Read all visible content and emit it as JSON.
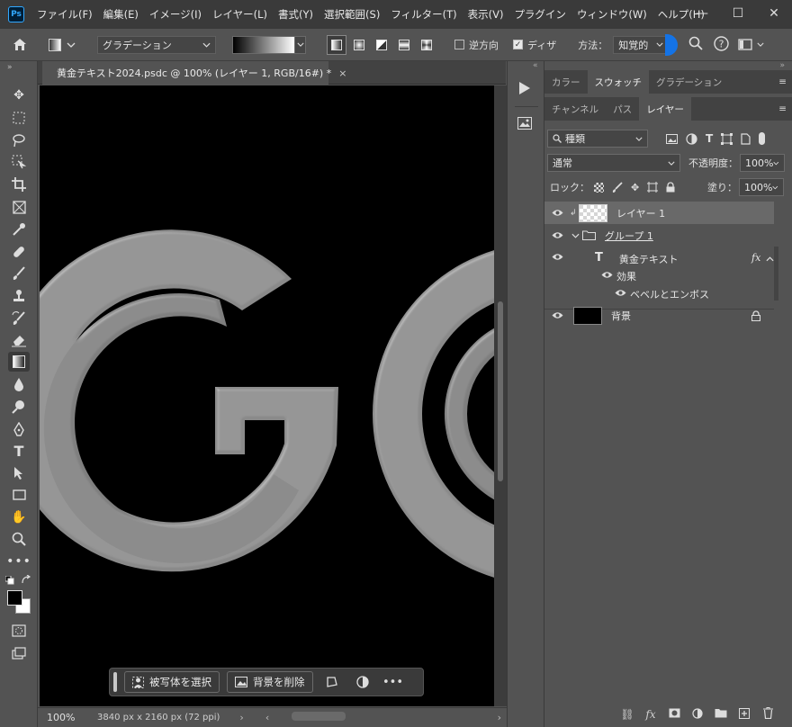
{
  "app": {
    "logo": "Ps"
  },
  "menu": [
    "ファイル(F)",
    "編集(E)",
    "イメージ(I)",
    "レイヤー(L)",
    "書式(Y)",
    "選択範囲(S)",
    "フィルター(T)",
    "表示(V)",
    "プラグイン",
    "ウィンドウ(W)",
    "ヘルプ(H)"
  ],
  "window_controls": {
    "minimize": "—",
    "maximize": "☐",
    "close": "✕"
  },
  "options": {
    "gradient_mode": "グラデーション",
    "reverse_label": "逆方向",
    "reverse_checked": false,
    "dither_label": "ディザ",
    "dither_checked": true,
    "method_label": "方法：",
    "method_value": "知覚的"
  },
  "document": {
    "tab_title": "黄金テキスト2024.psdc @ 100% (レイヤー 1, RGB/16#) *",
    "canvas_text": "GO",
    "zoom": "100%",
    "dimensions": "3840 px x 2160 px (72 ppi)"
  },
  "contextual_bar": {
    "select_subject": "被写体を選択",
    "remove_background": "背景を削除"
  },
  "panels": {
    "top_tabs": [
      "カラー",
      "スウォッチ",
      "グラデーション"
    ],
    "top_active": 1,
    "layer_tabs": [
      "チャンネル",
      "パス",
      "レイヤー"
    ],
    "layer_active": 2,
    "filter_kind": "種類",
    "blend_mode": "通常",
    "opacity_label": "不透明度：",
    "opacity_value": "100%",
    "lock_label": "ロック：",
    "fill_label": "塗り：",
    "fill_value": "100%"
  },
  "layers": [
    {
      "name": "レイヤー 1",
      "selected": true,
      "thumb": "checker"
    },
    {
      "name": "グループ 1",
      "type": "group"
    },
    {
      "name": "黄金テキスト",
      "type": "text",
      "fx": "fx"
    },
    {
      "name": "効果",
      "type": "effects"
    },
    {
      "name": "ベベルとエンボス",
      "type": "effect"
    },
    {
      "name": "背景",
      "thumb": "black"
    }
  ],
  "colors": {
    "ui_dark": "#3a3a3a",
    "ui_mid": "#535353",
    "accent": "#1473e6",
    "letter_gray": "#8a8a8a"
  }
}
